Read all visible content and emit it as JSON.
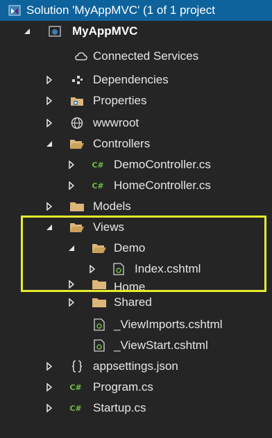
{
  "solution": {
    "label": "Solution 'MyAppMVC' (1 of 1 project"
  },
  "project": {
    "label": "MyAppMVC"
  },
  "items": {
    "connected_services": "Connected Services",
    "dependencies": "Dependencies",
    "properties": "Properties",
    "wwwroot": "wwwroot",
    "controllers": "Controllers",
    "demo_controller": "DemoController.cs",
    "home_controller": "HomeController.cs",
    "models": "Models",
    "views": "Views",
    "demo": "Demo",
    "index": "Index.cshtml",
    "home": "Home",
    "shared": "Shared",
    "view_imports": "_ViewImports.cshtml",
    "view_start": "_ViewStart.cshtml",
    "appsettings": "appsettings.json",
    "program": "Program.cs",
    "startup": "Startup.cs"
  },
  "csharp_badge": "C#",
  "colors": {
    "background": "#252526",
    "selection": "#0e639c",
    "folder": "#dcb67a",
    "highlight_box": "#e3ed2b",
    "csharp": "#6fbf3f"
  }
}
